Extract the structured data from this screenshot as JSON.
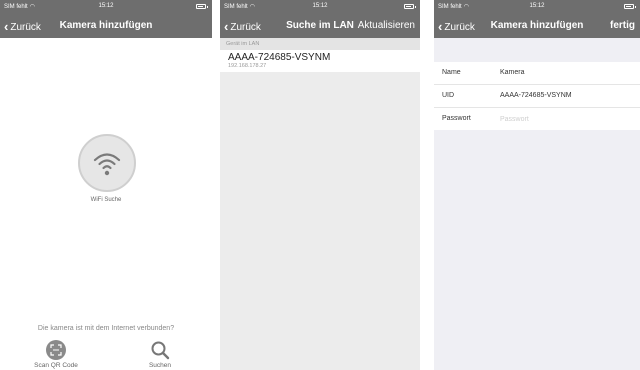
{
  "status_bar": {
    "carrier": "SIM fehlt",
    "time": "15:12"
  },
  "screen_add_camera": {
    "back_label": "Zurück",
    "title": "Kamera hinzufügen",
    "wifi_label": "WiFi Suche",
    "connected_question": "Die kamera ist mit dem Internet verbunden?",
    "qr_label": "Scan QR Code",
    "search_label": "Suchen"
  },
  "screen_lan_search": {
    "back_label": "Zurück",
    "title": "Suche im LAN",
    "refresh_label": "Aktualisieren",
    "section_header": "Gerät im LAN",
    "devices": [
      {
        "uid": "AAAA-724685-VSYNM",
        "ip": "192.168.178.27"
      }
    ]
  },
  "screen_camera_form": {
    "back_label": "Zurück",
    "title": "Kamera hinzufügen",
    "done_label": "fertig",
    "fields": {
      "name": {
        "label": "Name",
        "value": "Kamera"
      },
      "uid": {
        "label": "UID",
        "value": "AAAA-724685-VSYNM"
      },
      "password": {
        "label": "Passwort",
        "placeholder": "Passwort"
      }
    }
  }
}
